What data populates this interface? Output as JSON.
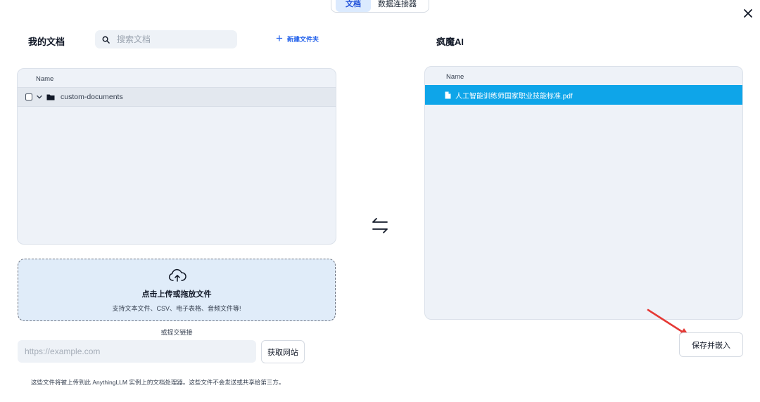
{
  "tabs": [
    {
      "label": "文档",
      "active": true
    },
    {
      "label": "数据连接器",
      "active": false
    }
  ],
  "left": {
    "title": "我的文档",
    "search_placeholder": "搜索文档",
    "new_folder_label": "新建文件夹",
    "column_header": "Name",
    "folder_name": "custom-documents"
  },
  "upload": {
    "title": "点击上传或拖放文件",
    "subtitle": "支持文本文件、CSV、电子表格、音频文件等!"
  },
  "link": {
    "or_label": "或提交链接",
    "url_placeholder": "https://example.com",
    "fetch_button": "获取网站"
  },
  "footer_note": "这些文件将被上传到此 AnythingLLM 实例上的文档处理器。这些文件不会发送或共享给第三方。",
  "right": {
    "title": "疯魔AI",
    "column_header": "Name",
    "document_name": "人工智能训练师国家职业技能标准.pdf",
    "save_button": "保存并嵌入"
  },
  "colors": {
    "accent": "#2563eb",
    "selected_row": "#0ea5e9",
    "annotation_arrow": "#e53935"
  }
}
